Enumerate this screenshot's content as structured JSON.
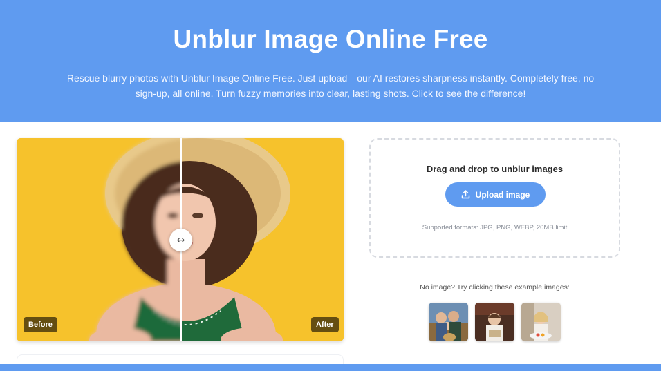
{
  "hero": {
    "title": "Unblur Image Online Free",
    "description": "Rescue blurry photos with Unblur Image Online Free. Just upload—our AI restores sharpness instantly. Completely free, no sign-up, all online. Turn fuzzy memories into clear, lasting shots. Click to see the difference!"
  },
  "compare": {
    "before_label": "Before",
    "after_label": "After",
    "handle_glyph": "↔"
  },
  "upload": {
    "title": "Drag and drop to unblur images",
    "button_label": "Upload image",
    "formats": "Supported formats: JPG, PNG, WEBP, 20MB limit"
  },
  "examples": {
    "label": "No image? Try clicking these example images:",
    "items": [
      "example-family-photo",
      "example-boy-reading",
      "example-girl-eating"
    ]
  },
  "colors": {
    "accent": "#5f9bf0",
    "photo_background": "#f6c22c"
  }
}
